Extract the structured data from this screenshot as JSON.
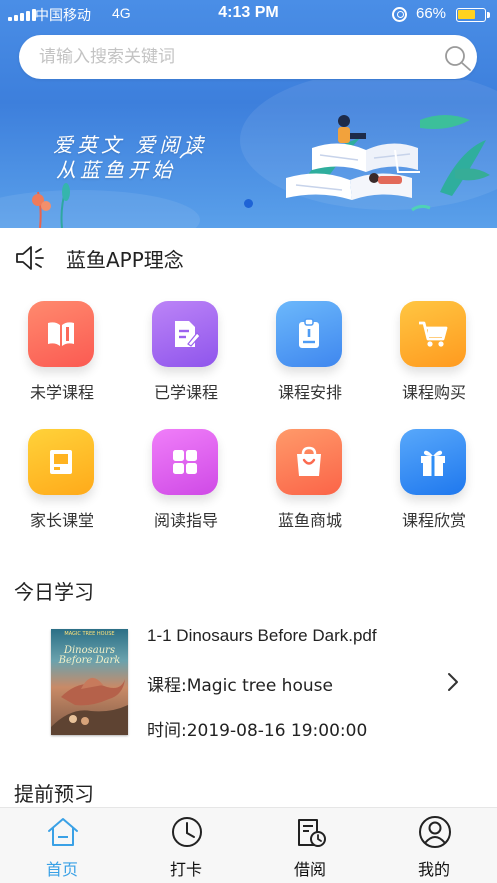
{
  "status_bar": {
    "carrier": "中国移动",
    "network": "4G",
    "time": "4:13 PM",
    "battery_percent": "66%",
    "battery_level": 0.66
  },
  "search": {
    "placeholder": "请输入搜索关键词",
    "value": "",
    "icon": "search-icon"
  },
  "banner": {
    "line1": "爱英文 爱阅读",
    "line2": "从蓝鱼开始",
    "slide_count": 1,
    "active_slide": 1
  },
  "notice": {
    "icon": "speaker-icon",
    "text": "蓝鱼APP理念"
  },
  "grid": {
    "items": [
      {
        "label": "未学课程",
        "icon": "book-icon",
        "color": "#ff6a5c"
      },
      {
        "label": "已学课程",
        "icon": "notepad-pencil-icon",
        "color": "#a86cf2"
      },
      {
        "label": "课程安排",
        "icon": "clipboard-icon",
        "color": "#4f9cf4"
      },
      {
        "label": "课程购买",
        "icon": "cart-icon",
        "color": "#ffa726"
      },
      {
        "label": "家长课堂",
        "icon": "notebook-icon",
        "color": "#ffb321"
      },
      {
        "label": "阅读指导",
        "icon": "grid-apps-icon",
        "color": "#e05af0"
      },
      {
        "label": "蓝鱼商城",
        "icon": "shopping-bag-icon",
        "color": "#ff7a55"
      },
      {
        "label": "课程欣赏",
        "icon": "gift-icon",
        "color": "#2f8ef6"
      }
    ]
  },
  "today": {
    "title": "今日学习",
    "item": {
      "book_series": "MAGIC TREE HOUSE",
      "book_title": "Dinosaurs Before Dark",
      "filename": "1-1 Dinosaurs Before Dark.pdf",
      "course": "课程:Magic tree house",
      "time": "时间:2019-08-16 19:00:00"
    }
  },
  "preview": {
    "title": "提前预习"
  },
  "tabs": [
    {
      "label": "首页",
      "icon": "home-icon",
      "active": true
    },
    {
      "label": "打卡",
      "icon": "clock-icon",
      "active": false
    },
    {
      "label": "借阅",
      "icon": "borrow-book-icon",
      "active": false
    },
    {
      "label": "我的",
      "icon": "user-icon",
      "active": false
    }
  ],
  "colors": {
    "accent": "#3aa1e6",
    "banner_blue": "#3d7fdc",
    "battery": "#ffd21f"
  }
}
